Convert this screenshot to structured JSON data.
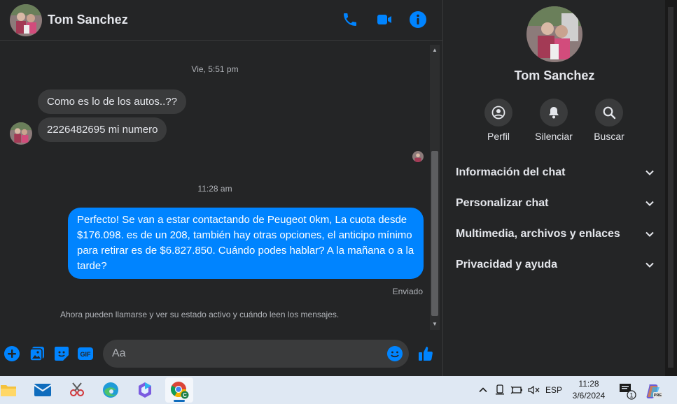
{
  "contact": {
    "name": "Tom Sanchez"
  },
  "chat": {
    "timestamp_1": "Vie, 5:51 pm",
    "incoming": [
      "Como es lo de los autos..??",
      "2226482695 mi numero"
    ],
    "timestamp_2": "11:28 am",
    "outgoing": "Perfecto!  Se van a estar contactando de Peugeot 0km, La cuota desde $176.098. es de un 208, también hay otras opciones, el anticipo mínimo para retirar es de $6.827.850. Cuándo podes hablar? A la mañana o a la tarde?",
    "status": "Enviado",
    "notice": "Ahora pueden llamarse y ver su estado activo y cuándo leen los mensajes."
  },
  "composer": {
    "placeholder": "Aa"
  },
  "side": {
    "actions": [
      {
        "label": "Perfil",
        "icon": "profile-icon"
      },
      {
        "label": "Silenciar",
        "icon": "bell-icon"
      },
      {
        "label": "Buscar",
        "icon": "search-icon"
      }
    ],
    "sections": [
      "Información del chat",
      "Personalizar chat",
      "Multimedia, archivos y enlaces",
      "Privacidad y ayuda"
    ]
  },
  "taskbar": {
    "language": "ESP",
    "time": "11:28",
    "date": "3/6/2024",
    "notification_count": "1",
    "chrome_badge": "C",
    "copilot_badge": "PRE"
  },
  "colors": {
    "accent": "#0084ff",
    "background": "#242526",
    "bubble_in": "#3a3b3c",
    "taskbar": "#dfe8f3"
  }
}
